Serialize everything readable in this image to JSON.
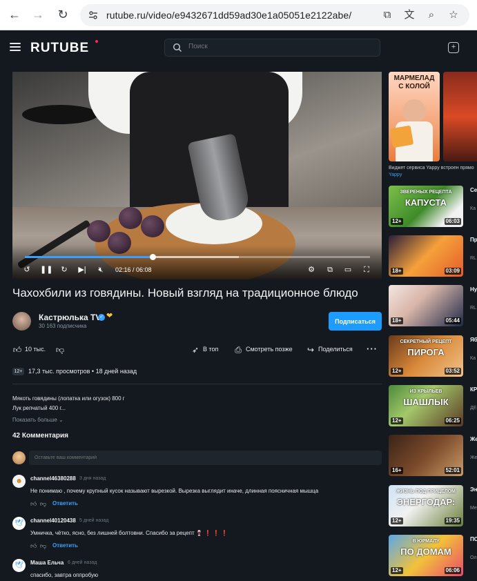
{
  "browser": {
    "url": "rutube.ru/video/e9432671dd59ad30e1a05051e2122abe/"
  },
  "header": {
    "logo": "RUTUBE",
    "search_placeholder": "Поиск"
  },
  "player": {
    "current_time": "02:16",
    "duration": "06:08",
    "time_label": "02:16 / 06:08",
    "progress": 0.37,
    "buffered": 0.62
  },
  "video": {
    "title": "Чахохбили из говядины. Новый взгляд на традиционное блюдо",
    "channel_name": "Кастрюлька TV",
    "subscribers": "30 163 подписчика",
    "subscribe_label": "Подписаться",
    "likes": "10 тыс.",
    "action_top": "В топ",
    "action_later": "Смотреть позже",
    "action_share": "Поделиться",
    "age_rating": "12+",
    "views": "17,3 тыс. просмотров",
    "date": "18 дней назад",
    "description_lines": [
      "Мякоть говядины (лопатка или огузок) 800 г",
      "Лук репчатый 400 г..."
    ],
    "show_more": "Показать больше"
  },
  "comments": {
    "count_label": "42 Комментария",
    "input_placeholder": "Оставьте ваш комментарий",
    "reply_label": "Ответить",
    "items": [
      {
        "author": "channel46380288",
        "time": "3 дня назад",
        "text": "Не понимаю , почему крупный кусок называют вырезкой. Вырезка выглядит иначе, длинная поясничная мышца"
      },
      {
        "author": "channel40120438",
        "time": "5 дней назад",
        "text": "Умничка, чётко, ясно, без лишней болтовни. Спасибо за рецепт 🍷 ❗ ❗ ❗"
      },
      {
        "author": "Маша Ельча",
        "time": "6 дней назад",
        "text": "спасибо, завтра оппробую"
      }
    ]
  },
  "sidebar": {
    "ad_caption": "МАРМЕЛАД С КОЛОЙ",
    "ad_line": "Виджет сервиса Yappy встроен прямо",
    "ad_brand": "Yappy",
    "items": [
      {
        "title": "Се",
        "channel": "Ка",
        "duration": "06:03",
        "age": "12+",
        "caption": "КАПУСТА",
        "caption2": "ЗВЕРЕНЫХ РЕЦЕПТА"
      },
      {
        "title": "Пр",
        "channel": "RL",
        "duration": "03:09",
        "age": "18+",
        "caption": "",
        "caption2": ""
      },
      {
        "title": "Ну",
        "channel": "RL",
        "duration": "05:44",
        "age": "18+",
        "caption": "",
        "caption2": ""
      },
      {
        "title": "Яб",
        "channel": "Ка",
        "duration": "03:52",
        "age": "12+",
        "caption": "ПИРОГА",
        "caption2": "СЕКРЕТНЫЙ РЕЦЕПТ"
      },
      {
        "title": "КР",
        "channel": "ДЕ",
        "duration": "06:25",
        "age": "12+",
        "caption": "ШАШЛЫК",
        "caption2": "ИЗ КРЫЛЬЕВ"
      },
      {
        "title": "Же",
        "channel": "Же",
        "duration": "52:01",
        "age": "16+",
        "caption": "",
        "caption2": ""
      },
      {
        "title": "Эн",
        "channel": "Ме",
        "duration": "19:35",
        "age": "12+",
        "caption": "ЭНЕРГОДАР:",
        "caption2": "ЖИЗНЬ ПОД ПРИЦЕЛОМ"
      },
      {
        "title": "ПС",
        "channel": "Ол",
        "duration": "06:06",
        "age": "12+",
        "caption": "ПО ДОМАМ",
        "caption2": "В ЮРМАЛУ"
      }
    ]
  },
  "colors": {
    "background": "#14191f",
    "accent": "#1e9bff",
    "logo_dot": "#ff2b4e"
  }
}
